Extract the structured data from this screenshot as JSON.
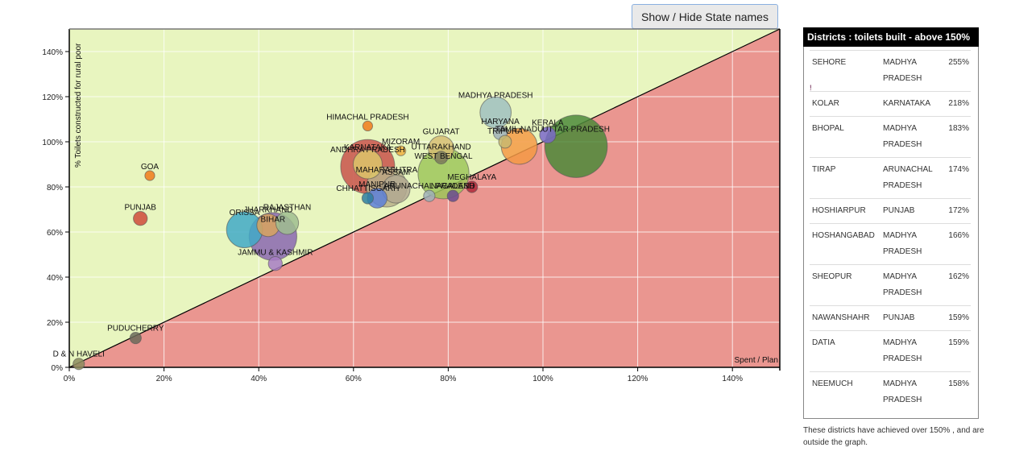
{
  "toolbar": {
    "toggle_label": "Show / Hide State names"
  },
  "chart_data": {
    "type": "scatter",
    "subtype": "bubble",
    "title": "",
    "xlabel": "Spent / Plan",
    "ylabel": "% Toilets constructed for rural poor",
    "xlim": [
      0,
      150
    ],
    "ylim": [
      0,
      150
    ],
    "x_ticks": [
      "0%",
      "20%",
      "40%",
      "60%",
      "80%",
      "100%",
      "120%",
      "140%"
    ],
    "y_ticks": [
      "0%",
      "20%",
      "40%",
      "60%",
      "80%",
      "100%",
      "120%",
      "140%"
    ],
    "grid": true,
    "diagonal": "y = x",
    "regions": {
      "above_diagonal_color": "#e8f5bf",
      "below_diagonal_color": "#ea9690"
    },
    "points": [
      {
        "name": "D & N HAVELI",
        "x": 2,
        "y": 1.5,
        "size": 2,
        "color": "#8c8c5e"
      },
      {
        "name": "PUDUCHERRY",
        "x": 14,
        "y": 13,
        "size": 2,
        "color": "#6b6b5a"
      },
      {
        "name": "PUNJAB",
        "x": 15,
        "y": 66,
        "size": 3,
        "color": "#cf4a3a"
      },
      {
        "name": "GOA",
        "x": 17,
        "y": 85,
        "size": 1.5,
        "color": "#f07a1a"
      },
      {
        "name": "ORISSA",
        "x": 37,
        "y": 61,
        "size": 20,
        "color": "#41a9c7"
      },
      {
        "name": "JHARKHAND",
        "x": 42,
        "y": 63,
        "size": 8,
        "color": "#d8a35e"
      },
      {
        "name": "BIHAR",
        "x": 43,
        "y": 58,
        "size": 35,
        "color": "#8a67b0"
      },
      {
        "name": "RAJASTHAN",
        "x": 46,
        "y": 64,
        "size": 8,
        "color": "#9fbd8f"
      },
      {
        "name": "JAMMU & KASHMIR",
        "x": 43.5,
        "y": 46,
        "size": 3,
        "color": "#a77cc4"
      },
      {
        "name": "HIMACHAL PRADESH",
        "x": 63,
        "y": 107,
        "size": 1.5,
        "color": "#f07a1a"
      },
      {
        "name": "ANDHRA PRADESH",
        "x": 63,
        "y": 89,
        "size": 45,
        "color": "#c8524a"
      },
      {
        "name": "KARNATAKA",
        "x": 63,
        "y": 90,
        "size": 13,
        "color": "#dcc56a"
      },
      {
        "name": "MIZORAM",
        "x": 70,
        "y": 96,
        "size": 1.5,
        "color": "#f0b040"
      },
      {
        "name": "MAHARASHTRA",
        "x": 67,
        "y": 80,
        "size": 25,
        "color": "#b9b08a"
      },
      {
        "name": "ASSAM",
        "x": 69,
        "y": 79,
        "size": 12,
        "color": "#b2a890"
      },
      {
        "name": "CHHATTISGARH",
        "x": 63,
        "y": 75,
        "size": 2,
        "color": "#2e7fa0"
      },
      {
        "name": "MANIPUR",
        "x": 65,
        "y": 75,
        "size": 6,
        "color": "#5c7fd8"
      },
      {
        "name": "ARUNACHAL PRADESH",
        "x": 76,
        "y": 76,
        "size": 2,
        "color": "#9fb0b8"
      },
      {
        "name": "GUJARAT",
        "x": 78.5,
        "y": 97,
        "size": 10,
        "color": "#d6bd72"
      },
      {
        "name": "WEST BENGAL",
        "x": 79,
        "y": 86,
        "size": 40,
        "color": "#9dc55a"
      },
      {
        "name": "UTTARAKHAND",
        "x": 78.5,
        "y": 93,
        "size": 2.5,
        "color": "#7c7c5a"
      },
      {
        "name": "MEGHALAYA",
        "x": 85,
        "y": 80,
        "size": 2,
        "color": "#b0283a"
      },
      {
        "name": "NAGALAND",
        "x": 81,
        "y": 76,
        "size": 2,
        "color": "#6a4b90"
      },
      {
        "name": "MADHYA PRADESH",
        "x": 90,
        "y": 113,
        "size": 15,
        "color": "#9fc0c0"
      },
      {
        "name": "HARYANA",
        "x": 91,
        "y": 104,
        "size": 3,
        "color": "#9fb0b8"
      },
      {
        "name": "TAMIL NADU",
        "x": 95,
        "y": 98,
        "size": 20,
        "color": "#f49a45"
      },
      {
        "name": "TRIPURA",
        "x": 92,
        "y": 100,
        "size": 2.5,
        "color": "#c8b870"
      },
      {
        "name": "KERALA",
        "x": 101,
        "y": 103,
        "size": 4,
        "color": "#7a68c8"
      },
      {
        "name": "UTTAR PRADESH",
        "x": 107,
        "y": 98,
        "size": 60,
        "color": "#4c8a3a"
      }
    ]
  },
  "panel": {
    "title": "Districts : toilets built - above 150%",
    "stray_mark": "!",
    "rows": [
      {
        "district": "SEHORE",
        "state": "MADHYA PRADESH",
        "pct": "255%"
      },
      {
        "district": "KOLAR",
        "state": "KARNATAKA",
        "pct": "218%"
      },
      {
        "district": "BHOPAL",
        "state": "MADHYA PRADESH",
        "pct": "183%"
      },
      {
        "district": "TIRAP",
        "state": "ARUNACHAL PRADESH",
        "pct": "174%"
      },
      {
        "district": "HOSHIARPUR",
        "state": "PUNJAB",
        "pct": "172%"
      },
      {
        "district": "HOSHANGABAD",
        "state": "MADHYA PRADESH",
        "pct": "166%"
      },
      {
        "district": "SHEOPUR",
        "state": "MADHYA PRADESH",
        "pct": "162%"
      },
      {
        "district": "NAWANSHAHR",
        "state": "PUNJAB",
        "pct": "159%"
      },
      {
        "district": "DATIA",
        "state": "MADHYA PRADESH",
        "pct": "159%"
      },
      {
        "district": "NEEMUCH",
        "state": "MADHYA PRADESH",
        "pct": "158%"
      }
    ],
    "note": "These districts have achieved over 150% , and are outside the graph."
  }
}
